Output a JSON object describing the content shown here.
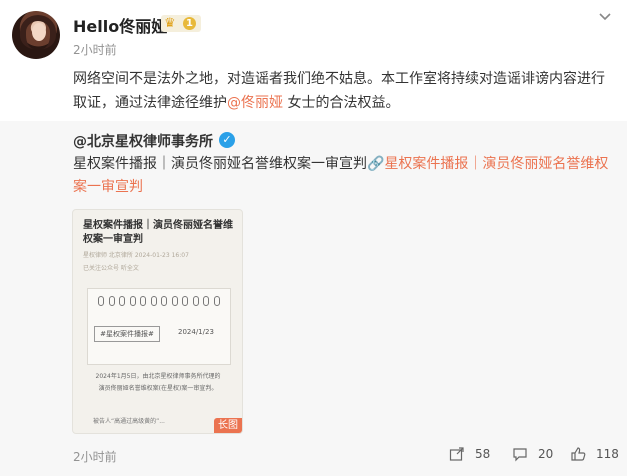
{
  "post": {
    "username": "Hello佟丽娅",
    "vip_level": "1",
    "timestamp": "2小时前",
    "text_before": "网络空间不是法外之地，对造谣者我们绝不姑息。本工作室将持续对造谣诽谤内容进行取证，通过法律途径维护",
    "mention": "@佟丽娅",
    "text_after": " 女士的合法权益。"
  },
  "repost": {
    "author": "@北京星权律师事务所",
    "text": "星权案件播报｜演员佟丽娅名誉维权案一审宣判",
    "link_label": "星权案件播报｜演员佟丽娅名誉维权案一审宣判",
    "thumbnail": {
      "title": "星权案件播报｜演员佟丽娅名誉维权案一审宣判",
      "meta1": "星权律师   北京律所   2024-01-23 16:07",
      "meta2": "已关注公众号   听全文",
      "tag": "#星权案件播报#",
      "tag_date": "2024/1/23",
      "body": "2024年1月5日，由北京星权律师事务所代理的演员佟丽娅名誉维权案(在星权)案一审宣判。",
      "bottom": "被告人“高通过高级黄的”...",
      "long_label": "长图"
    },
    "timestamp": "2小时前",
    "shares": "58",
    "comments": "20",
    "likes": "118"
  },
  "colors": {
    "accent": "#eb7350",
    "verified": "#2aa0e8",
    "vip": "#e8b93a"
  },
  "icons": [
    "chevron-down-icon",
    "crown-icon",
    "verified-icon",
    "link-icon",
    "share-icon",
    "comment-icon",
    "like-icon"
  ]
}
